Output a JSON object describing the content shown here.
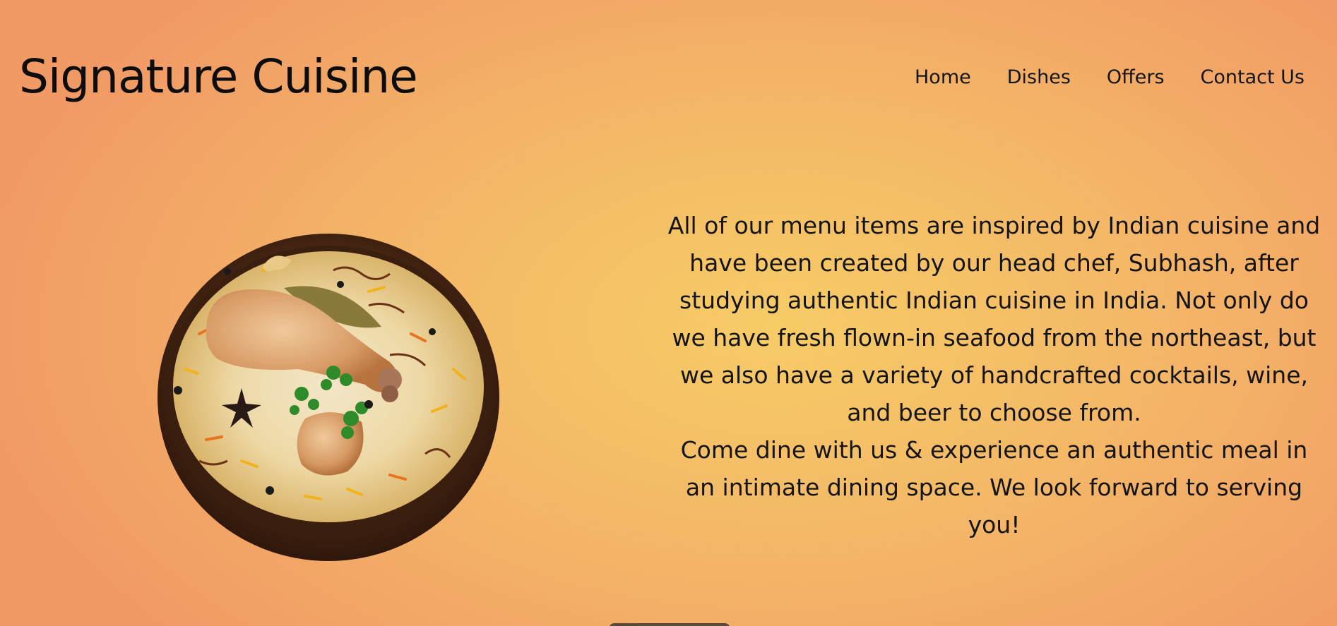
{
  "brand": {
    "title": "Signature Cuisine"
  },
  "nav": {
    "items": [
      {
        "label": "Home"
      },
      {
        "label": "Dishes"
      },
      {
        "label": "Offers"
      },
      {
        "label": "Contact Us"
      }
    ]
  },
  "hero": {
    "image_subject": "chicken-biryani-bowl",
    "paragraph_1": "All of our menu items are inspired by Indian cuisine and have been created by our head chef, Subhash, after studying authentic Indian cuisine in India. Not only do we have fresh flown-in seafood from the northeast, but we also have a variety of handcrafted cocktails, wine, and beer to choose from.",
    "paragraph_2": "Come dine with us & experience an authentic meal in an intimate dining space. We look forward to serving you!"
  },
  "colors": {
    "background_center": "#f6cc66",
    "background_edge": "#f19a66",
    "text": "#141414"
  }
}
